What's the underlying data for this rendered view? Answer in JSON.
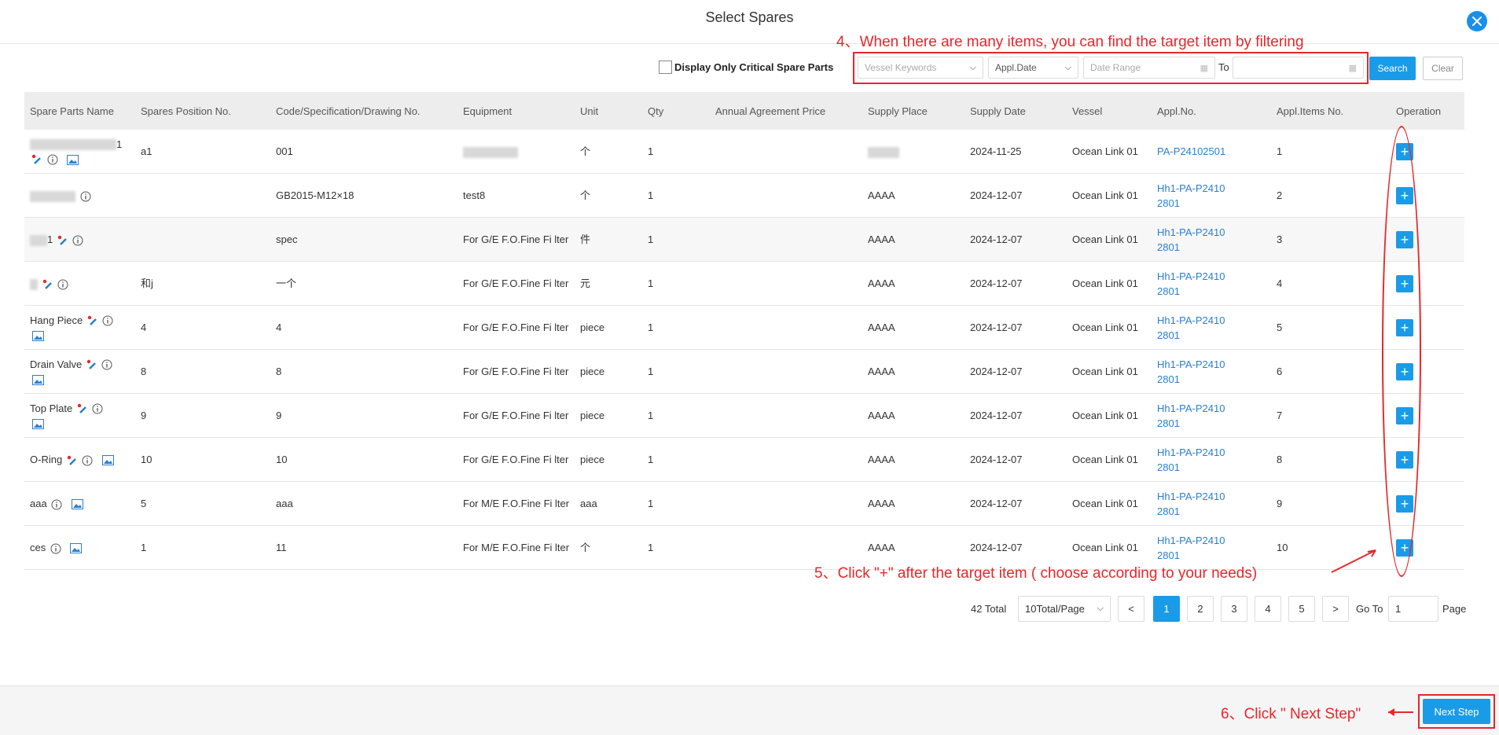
{
  "dialog": {
    "title": "Select Spares"
  },
  "filters": {
    "critical_label": "Display Only Critical Spare Parts",
    "vessel_placeholder": "Vessel Keywords",
    "date_type": "Appl.Date",
    "date_range_placeholder": "Date Range",
    "to_label": "To",
    "search_label": "Search",
    "clear_label": "Clear"
  },
  "annotations": {
    "step4": "4、When there are many items, you can find the target item by filtering",
    "step5": "5、Click \"+\" after the target item ( choose according to your needs)",
    "step6": "6、Click \" Next Step\""
  },
  "table": {
    "headers": [
      "Spare Parts Name",
      "Spares Position No.",
      "Code/Specification/Drawing No.",
      "Equipment",
      "Unit",
      "Qty",
      "Annual Agreement Price",
      "Supply Place",
      "Supply Date",
      "Vessel",
      "Appl.No.",
      "Appl.Items No.",
      "Operation"
    ],
    "rows": [
      {
        "name": "1",
        "pos": "a1",
        "code": "001",
        "equip": "",
        "unit": "个",
        "qty": "1",
        "price": "",
        "place": "",
        "date": "2024-11-25",
        "vessel": "Ocean Link 01",
        "appl1": "PA-P24102501",
        "appl2": "",
        "items": "1"
      },
      {
        "name": "",
        "pos": "",
        "code": "GB2015-M12×18",
        "equip": "test8",
        "unit": "个",
        "qty": "1",
        "price": "",
        "place": "AAAA",
        "date": "2024-12-07",
        "vessel": "Ocean Link 01",
        "appl1": "Hh1-PA-P2410",
        "appl2": "2801",
        "items": "2"
      },
      {
        "name": "1",
        "pos": "",
        "code": "spec",
        "equip": "For G/E F.O.Fine Fi lter",
        "unit": "件",
        "qty": "1",
        "price": "",
        "place": "AAAA",
        "date": "2024-12-07",
        "vessel": "Ocean Link 01",
        "appl1": "Hh1-PA-P2410",
        "appl2": "2801",
        "items": "3"
      },
      {
        "name": "",
        "pos": "和j",
        "code": "一个",
        "equip": "For G/E F.O.Fine Fi lter",
        "unit": "元",
        "qty": "1",
        "price": "",
        "place": "AAAA",
        "date": "2024-12-07",
        "vessel": "Ocean Link 01",
        "appl1": "Hh1-PA-P2410",
        "appl2": "2801",
        "items": "4"
      },
      {
        "name": "Hang Piece",
        "pos": "4",
        "code": "4",
        "equip": "For G/E F.O.Fine Fi lter",
        "unit": "piece",
        "qty": "1",
        "price": "",
        "place": "AAAA",
        "date": "2024-12-07",
        "vessel": "Ocean Link 01",
        "appl1": "Hh1-PA-P2410",
        "appl2": "2801",
        "items": "5"
      },
      {
        "name": "Drain Valve",
        "pos": "8",
        "code": "8",
        "equip": "For G/E F.O.Fine Fi lter",
        "unit": "piece",
        "qty": "1",
        "price": "",
        "place": "AAAA",
        "date": "2024-12-07",
        "vessel": "Ocean Link 01",
        "appl1": "Hh1-PA-P2410",
        "appl2": "2801",
        "items": "6"
      },
      {
        "name": "Top Plate",
        "pos": "9",
        "code": "9",
        "equip": "For G/E F.O.Fine Fi lter",
        "unit": "piece",
        "qty": "1",
        "price": "",
        "place": "AAAA",
        "date": "2024-12-07",
        "vessel": "Ocean Link 01",
        "appl1": "Hh1-PA-P2410",
        "appl2": "2801",
        "items": "7"
      },
      {
        "name": "O-Ring",
        "pos": "10",
        "code": "10",
        "equip": "For G/E F.O.Fine Fi lter",
        "unit": "piece",
        "qty": "1",
        "price": "",
        "place": "AAAA",
        "date": "2024-12-07",
        "vessel": "Ocean Link 01",
        "appl1": "Hh1-PA-P2410",
        "appl2": "2801",
        "items": "8"
      },
      {
        "name": "aaa",
        "pos": "5",
        "code": "aaa",
        "equip": "For M/E F.O.Fine Fi lter",
        "unit": "aaa",
        "qty": "1",
        "price": "",
        "place": "AAAA",
        "date": "2024-12-07",
        "vessel": "Ocean Link 01",
        "appl1": "Hh1-PA-P2410",
        "appl2": "2801",
        "items": "9"
      },
      {
        "name": "ces",
        "pos": "1",
        "code": "11",
        "equip": "For M/E F.O.Fine Fi lter",
        "unit": "个",
        "qty": "1",
        "price": "",
        "place": "AAAA",
        "date": "2024-12-07",
        "vessel": "Ocean Link 01",
        "appl1": "Hh1-PA-P2410",
        "appl2": "2801",
        "items": "10"
      }
    ],
    "op_label": "+"
  },
  "pagination": {
    "total": "42 Total",
    "page_size": "10Total/Page",
    "prev": "<",
    "next": ">",
    "pages": [
      "1",
      "2",
      "3",
      "4",
      "5"
    ],
    "goto_label": "Go To",
    "goto_value": "1",
    "page_label": "Page"
  },
  "footer": {
    "next_label": "Next Step"
  },
  "colors": {
    "primary": "#1a9be8",
    "annotation": "#e8262a",
    "link": "#2a7fd1"
  }
}
